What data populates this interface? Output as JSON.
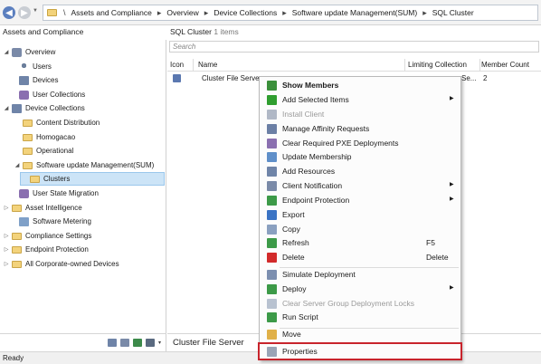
{
  "breadcrumb": {
    "items": [
      "Assets and Compliance",
      "Overview",
      "Device Collections",
      "Software update Management(SUM)",
      "SQL Cluster"
    ]
  },
  "left": {
    "workspace_header": "Assets and Compliance",
    "tree": [
      {
        "label": "Overview",
        "level": 0,
        "expanded": true,
        "icon": "overview-icon"
      },
      {
        "label": "Users",
        "level": 1,
        "icon": "user-icon"
      },
      {
        "label": "Devices",
        "level": 1,
        "icon": "device-icon"
      },
      {
        "label": "User Collections",
        "level": 1,
        "icon": "user-collections-icon"
      },
      {
        "label": "Device Collections",
        "level": 1,
        "expanded": true,
        "icon": "device-collections-icon"
      },
      {
        "label": "Content Distribution",
        "level": 2,
        "icon": "folder-icon"
      },
      {
        "label": "Homogacao",
        "level": 2,
        "icon": "folder-icon"
      },
      {
        "label": "Operational",
        "level": 2,
        "icon": "folder-icon"
      },
      {
        "label": "Software update Management(SUM)",
        "level": 2,
        "expanded": true,
        "icon": "folder-icon"
      },
      {
        "label": "Clusters",
        "level": 3,
        "selected": true,
        "icon": "folder-icon"
      },
      {
        "label": "User State Migration",
        "level": 1,
        "icon": "user-state-migration-icon"
      },
      {
        "label": "Asset Intelligence",
        "level": 1,
        "collapsed": true,
        "icon": "folder-icon"
      },
      {
        "label": "Software Metering",
        "level": 1,
        "icon": "software-metering-icon"
      },
      {
        "label": "Compliance Settings",
        "level": 1,
        "collapsed": true,
        "icon": "folder-icon"
      },
      {
        "label": "Endpoint Protection",
        "level": 1,
        "collapsed": true,
        "icon": "folder-icon"
      },
      {
        "label": "All Corporate-owned Devices",
        "level": 1,
        "collapsed": true,
        "icon": "folder-icon"
      }
    ]
  },
  "content": {
    "title": "SQL Cluster",
    "count": "1 items",
    "search_placeholder": "Search",
    "columns": [
      "Icon",
      "Name",
      "Limiting Collection",
      "Member Count"
    ],
    "rows": [
      {
        "name": "Cluster File Server",
        "limiting": "Se...",
        "member_count": "2"
      }
    ],
    "detail_title": "Cluster File Server"
  },
  "context_menu": {
    "items": [
      {
        "label": "Show Members",
        "bold": true,
        "icon": "show-members-icon",
        "color": "#3a8f3a"
      },
      {
        "label": "Add Selected Items",
        "submenu": true,
        "icon": "add-icon",
        "color": "#2f9e2f"
      },
      {
        "label": "Install Client",
        "disabled": true,
        "icon": "install-client-icon",
        "color": "#b0b8c6"
      },
      {
        "label": "Manage Affinity Requests",
        "icon": "affinity-icon",
        "color": "#6b7fa5"
      },
      {
        "label": "Clear Required PXE Deployments",
        "icon": "pxe-icon",
        "color": "#8a6fb0"
      },
      {
        "label": "Update Membership",
        "icon": "update-membership-icon",
        "color": "#5f8fc9"
      },
      {
        "label": "Add Resources",
        "icon": "add-resources-icon",
        "color": "#6f84a8"
      },
      {
        "label": "Client Notification",
        "submenu": true,
        "icon": "client-notification-icon",
        "color": "#7a8aa8"
      },
      {
        "label": "Endpoint Protection",
        "submenu": true,
        "icon": "endpoint-protection-icon",
        "color": "#3c9a48"
      },
      {
        "label": "Export",
        "icon": "export-icon",
        "color": "#3a73c4"
      },
      {
        "label": "Copy",
        "icon": "copy-icon",
        "color": "#8aa0c0"
      },
      {
        "label": "Refresh",
        "shortcut": "F5",
        "icon": "refresh-icon",
        "color": "#3c9a48"
      },
      {
        "label": "Delete",
        "shortcut": "Delete",
        "icon": "delete-icon",
        "color": "#d22a2a"
      },
      {
        "separator": true
      },
      {
        "label": "Simulate Deployment",
        "icon": "simulate-deployment-icon",
        "color": "#7c8fb0"
      },
      {
        "label": "Deploy",
        "submenu": true,
        "icon": "deploy-icon",
        "color": "#3c9a48"
      },
      {
        "label": "Clear Server Group Deployment Locks",
        "disabled": true,
        "icon": "deployment-locks-icon",
        "color": "#b8c2d0"
      },
      {
        "label": "Run Script",
        "icon": "run-script-icon",
        "color": "#3c9a48"
      },
      {
        "separator": true
      },
      {
        "label": "Move",
        "icon": "move-icon",
        "color": "#e0b048"
      },
      {
        "separator": true
      },
      {
        "label": "Properties",
        "icon": "properties-icon",
        "color": "#9aa4b6",
        "highlighted": true
      }
    ]
  },
  "status": {
    "text": "Ready"
  }
}
